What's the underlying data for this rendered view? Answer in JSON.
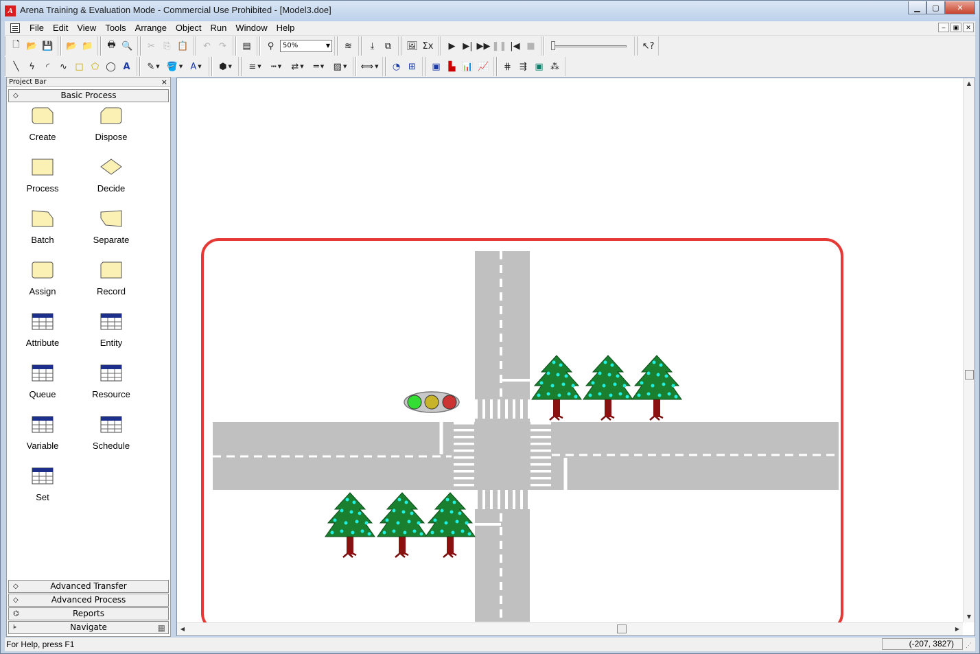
{
  "window": {
    "title": "Arena Training & Evaluation Mode - Commercial Use Prohibited - [Model3.doe]",
    "app_icon_letter": "A",
    "minimize_glyph": "▁",
    "maximize_glyph": "▢",
    "close_glyph": "✕"
  },
  "menubar": {
    "items": [
      "File",
      "Edit",
      "View",
      "Tools",
      "Arrange",
      "Object",
      "Run",
      "Window",
      "Help"
    ],
    "mdi_minimize": "–",
    "mdi_restore": "▣",
    "mdi_close": "✕"
  },
  "toolbar": {
    "zoom_value": "50%"
  },
  "project_bar": {
    "title": "Project Bar",
    "close_glyph": "×",
    "active_panel": "Basic Process",
    "modules": [
      {
        "label": "Create",
        "icon": "create-shape-icon"
      },
      {
        "label": "Dispose",
        "icon": "dispose-shape-icon"
      },
      {
        "label": "Process",
        "icon": "process-shape-icon"
      },
      {
        "label": "Decide",
        "icon": "decide-diamond-icon"
      },
      {
        "label": "Batch",
        "icon": "batch-shape-icon"
      },
      {
        "label": "Separate",
        "icon": "separate-shape-icon"
      },
      {
        "label": "Assign",
        "icon": "assign-shape-icon"
      },
      {
        "label": "Record",
        "icon": "record-shape-icon"
      },
      {
        "label": "Attribute",
        "icon": "attribute-table-icon"
      },
      {
        "label": "Entity",
        "icon": "entity-table-icon"
      },
      {
        "label": "Queue",
        "icon": "queue-table-icon"
      },
      {
        "label": "Resource",
        "icon": "resource-table-icon"
      },
      {
        "label": "Variable",
        "icon": "variable-table-icon"
      },
      {
        "label": "Schedule",
        "icon": "schedule-table-icon"
      },
      {
        "label": "Set",
        "icon": "set-table-icon"
      }
    ],
    "other_panels": [
      "Advanced Transfer",
      "Advanced Process",
      "Reports",
      "Navigate"
    ]
  },
  "canvas": {
    "highlight_color": "#e53935",
    "road_color": "#c0c0c0",
    "tree_color": "#1a7f2e",
    "traffic_lights": [
      "#33dd33",
      "#c8b42a",
      "#cc3333"
    ]
  },
  "statusbar": {
    "help_text": "For Help, press F1",
    "coordinates": "(-207, 3827)"
  }
}
